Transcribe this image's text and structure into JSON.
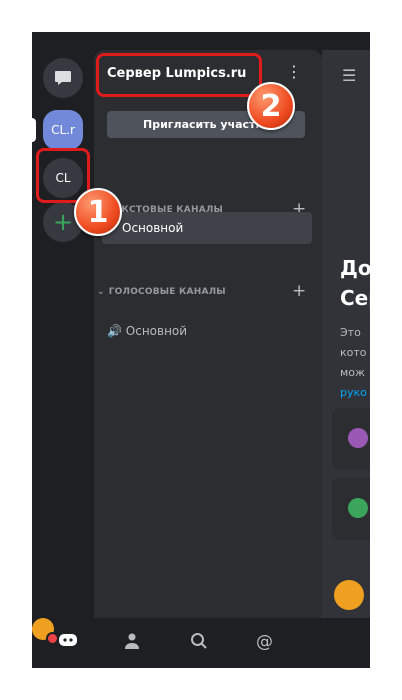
{
  "servers": {
    "server1_label": "CL.r",
    "server2_label": "CL",
    "add_label": "+"
  },
  "panel": {
    "server_name": "Сервер Lumpics.ru",
    "more": "⋮",
    "invite_label": "Пригласить участник",
    "text_category": "ТЕКСТОВЫЕ КАНАЛЫ",
    "text_channel": "Основной",
    "voice_category": "ГОЛОСОВЫЕ КАНАЛЫ",
    "voice_channel": "Основной",
    "add_symbol": "+"
  },
  "main": {
    "welcome_line1": "До",
    "welcome_line2": "Сер",
    "text1": "Это",
    "text2": "кото",
    "text3": "мож",
    "link": "руко"
  },
  "annotations": {
    "badge1": "1",
    "badge2": "2"
  },
  "colors": {
    "accent": "#7289da",
    "highlight_red": "#e01b1b",
    "badge_orange": "#ef4a1f"
  }
}
